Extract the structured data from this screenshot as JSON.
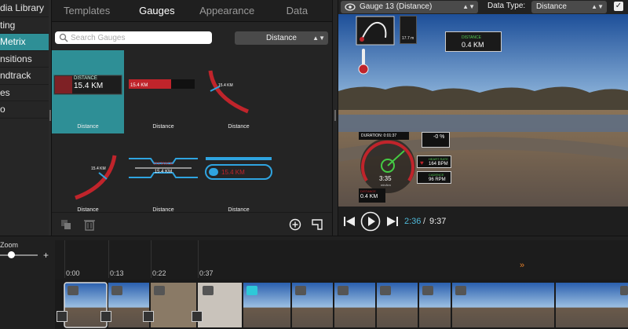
{
  "sidebar": {
    "items": [
      {
        "label": "dia Library",
        "active": false
      },
      {
        "label": "ting",
        "active": false
      },
      {
        "label": "Metrix",
        "active": true
      },
      {
        "label": "nsitions",
        "active": false
      },
      {
        "label": "ndtrack",
        "active": false
      },
      {
        "label": "es",
        "active": false
      },
      {
        "label": "o",
        "active": false
      }
    ]
  },
  "tabs": [
    {
      "label": "Templates",
      "active": false
    },
    {
      "label": "Gauges",
      "active": true
    },
    {
      "label": "Appearance",
      "active": false
    },
    {
      "label": "Data",
      "active": false
    }
  ],
  "search": {
    "placeholder": "Search Gauges",
    "value": ""
  },
  "filter": {
    "selected": "Distance"
  },
  "gauges": [
    {
      "name": "Distance",
      "label": "DISTANCE",
      "value": "15.4 KM",
      "style": "box",
      "selected": true
    },
    {
      "name": "Distance",
      "label": "",
      "value": "15.4 KM",
      "style": "bar",
      "selected": false
    },
    {
      "name": "Distance",
      "label": "",
      "value": "15.4 KM",
      "style": "arc",
      "selected": false
    },
    {
      "name": "Distance",
      "label": "",
      "value": "15.4 KM",
      "style": "arc2",
      "selected": false
    },
    {
      "name": "Distance",
      "label": "DISTANCE",
      "value": "15.4 KM",
      "style": "wings",
      "selected": false
    },
    {
      "name": "Distance",
      "label": "",
      "value": "15.4 KM",
      "style": "pill",
      "selected": false
    }
  ],
  "preview": {
    "gauge_select": "Gauge 13 (Distance)",
    "data_type_label": "Data Type:",
    "data_type": "Distance",
    "visible_check": "✓"
  },
  "overlay": {
    "distance_label": "DISTANCE",
    "distance_value": "0.4 KM",
    "duration": "DURATION: 0:01:37",
    "grade": "-0 %",
    "heart_label": "HEART RATE",
    "heart_value": "164 BPM",
    "cadence_label": "CADENCE",
    "cadence_value": "96 RPM",
    "speed_time": "3:35",
    "speed_unit": "min/km",
    "dist2_label": "DISTANCE",
    "dist2_value": "0.4 KM",
    "map_value": "17.7 m"
  },
  "player": {
    "current": "2:36",
    "separator": "/",
    "total": "9:37"
  },
  "timeline": {
    "zoom_label": "Zoom",
    "zoom_plus": "+",
    "zoom_level": 0.2,
    "ticks": [
      "0:00",
      "0:13",
      "0:22",
      "0:37"
    ],
    "ff_icon": "»"
  },
  "colors": {
    "accent": "#2e8f96",
    "time_accent": "#4fb8d8",
    "gauge_red": "#c0242b",
    "gauge_blue": "#2fa4e0",
    "marker": "#e07d2a"
  }
}
